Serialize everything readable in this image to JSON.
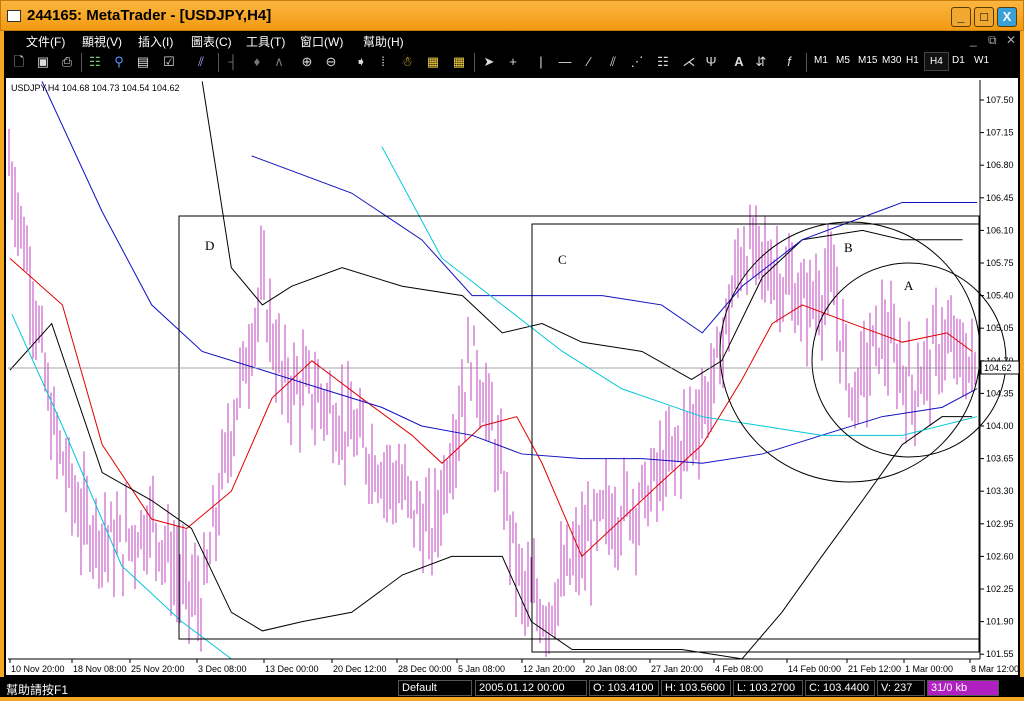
{
  "window": {
    "title": "244165: MetaTrader - [USDJPY,H4]",
    "min": "_",
    "max": "□",
    "close": "X"
  },
  "menu": [
    "文件(F)",
    "顯視(V)",
    "插入(I)",
    "圖表(C)",
    "工具(T)",
    "窗口(W)",
    "幫助(H)"
  ],
  "timeframes": [
    "M1",
    "M5",
    "M15",
    "M30",
    "H1",
    "H4",
    "D1",
    "W1"
  ],
  "active_timeframe": "H4",
  "chart": {
    "header": "USDJPY,H4  104.68 104.73 104.54 104.62",
    "current_price": "104.62",
    "price_ticks": [
      "107.50",
      "107.15",
      "106.80",
      "106.45",
      "106.10",
      "105.75",
      "105.40",
      "105.05",
      "104.70",
      "104.35",
      "104.00",
      "103.65",
      "103.30",
      "102.95",
      "102.60",
      "102.25",
      "101.90",
      "101.55"
    ],
    "date_ticks": [
      "10 Nov 20:00",
      "18 Nov 08:00",
      "25 Nov 20:00",
      "3 Dec 08:00",
      "13 Dec 00:00",
      "20 Dec 12:00",
      "28 Dec 00:00",
      "5 Jan 08:00",
      "12 Jan 20:00",
      "20 Jan 08:00",
      "27 Jan 20:00",
      "4 Feb 08:00",
      "14 Feb 00:00",
      "21 Feb 12:00",
      "1 Mar 00:00",
      "8 Mar 12:00"
    ],
    "labels": {
      "A": "A",
      "B": "B",
      "C": "C",
      "D": "D"
    }
  },
  "chart_data": {
    "type": "line",
    "ylim": [
      101.45,
      107.7
    ],
    "xlim": [
      0,
      100
    ],
    "price": [
      [
        0,
        106.9
      ],
      [
        2.5,
        105.5
      ],
      [
        4.5,
        104.0
      ],
      [
        7.5,
        103.0
      ],
      [
        11.6,
        102.7
      ],
      [
        14.8,
        103.0
      ],
      [
        17.9,
        102.3
      ],
      [
        20,
        102.1
      ],
      [
        23,
        104.0
      ],
      [
        26.2,
        105.5
      ],
      [
        28.2,
        104.5
      ],
      [
        32.3,
        104.3
      ],
      [
        36.4,
        103.8
      ],
      [
        40.6,
        103.3
      ],
      [
        43.7,
        102.8
      ],
      [
        47.8,
        104.8
      ],
      [
        49.8,
        104.0
      ],
      [
        53,
        102.2
      ],
      [
        55.5,
        102.0
      ],
      [
        58.1,
        102.5
      ],
      [
        61.2,
        103.0
      ],
      [
        65.3,
        103.2
      ],
      [
        69.4,
        103.8
      ],
      [
        72.5,
        104.4
      ],
      [
        75.6,
        105.9
      ],
      [
        78.7,
        105.7
      ],
      [
        81.8,
        105.3
      ],
      [
        84.9,
        105.5
      ],
      [
        86.9,
        104.3
      ],
      [
        90,
        105.0
      ],
      [
        93.1,
        104.4
      ],
      [
        96.2,
        104.9
      ],
      [
        99.3,
        104.62
      ]
    ],
    "series": [
      {
        "name": "ma-red",
        "color": "#e00000",
        "points": [
          [
            0.2,
            105.8
          ],
          [
            5.6,
            105.3
          ],
          [
            9.7,
            103.8
          ],
          [
            14.8,
            103.0
          ],
          [
            18.4,
            102.9
          ],
          [
            23,
            103.3
          ],
          [
            27.2,
            104.3
          ],
          [
            31.3,
            104.7
          ],
          [
            36.4,
            104.3
          ],
          [
            41.6,
            103.9
          ],
          [
            44.7,
            103.6
          ],
          [
            48.8,
            104.0
          ],
          [
            52.4,
            104.1
          ],
          [
            55,
            103.6
          ],
          [
            59.1,
            102.6
          ],
          [
            63.2,
            103.0
          ],
          [
            67.3,
            103.4
          ],
          [
            71.5,
            103.8
          ],
          [
            75.6,
            104.5
          ],
          [
            78.7,
            105.1
          ],
          [
            81.8,
            105.3
          ],
          [
            86.9,
            105.1
          ],
          [
            92.1,
            104.9
          ],
          [
            96.7,
            105.0
          ],
          [
            99.3,
            104.8
          ]
        ]
      },
      {
        "name": "band-upper",
        "color": "#000000",
        "points": [
          [
            20,
            107.7
          ],
          [
            23,
            105.7
          ],
          [
            26.2,
            105.3
          ],
          [
            29.2,
            105.5
          ],
          [
            34.4,
            105.7
          ],
          [
            40.6,
            105.5
          ],
          [
            46.8,
            105.4
          ],
          [
            50.9,
            105.0
          ],
          [
            55,
            105.1
          ],
          [
            59.1,
            104.9
          ],
          [
            65.3,
            104.8
          ],
          [
            70.4,
            104.5
          ],
          [
            73.5,
            104.7
          ],
          [
            77.7,
            105.6
          ],
          [
            81.8,
            106.0
          ],
          [
            88,
            106.1
          ],
          [
            92.1,
            106.0
          ],
          [
            98.3,
            106.0
          ]
        ]
      },
      {
        "name": "band-lower",
        "color": "#000000",
        "points": [
          [
            0.2,
            104.6
          ],
          [
            4.5,
            105.1
          ],
          [
            9.7,
            103.5
          ],
          [
            14.8,
            103.2
          ],
          [
            18.9,
            102.9
          ],
          [
            23,
            102.0
          ],
          [
            26.2,
            101.8
          ],
          [
            30.3,
            101.9
          ],
          [
            35.4,
            102.0
          ],
          [
            40.6,
            102.4
          ],
          [
            45.7,
            102.6
          ],
          [
            50.9,
            102.6
          ],
          [
            53.9,
            101.9
          ],
          [
            58.1,
            101.6
          ],
          [
            63.2,
            101.6
          ],
          [
            69.4,
            101.6
          ],
          [
            75.6,
            101.5
          ],
          [
            79.7,
            102.0
          ],
          [
            83.8,
            102.6
          ],
          [
            88,
            103.2
          ],
          [
            92.1,
            103.8
          ],
          [
            96.2,
            104.1
          ],
          [
            99.3,
            104.1
          ]
        ]
      },
      {
        "name": "ma-blue",
        "color": "#1010c0",
        "points": [
          [
            3.5,
            107.7
          ],
          [
            9.7,
            106.3
          ],
          [
            14.8,
            105.3
          ],
          [
            20,
            104.8
          ],
          [
            26.2,
            104.6
          ],
          [
            32.3,
            104.4
          ],
          [
            38.5,
            104.2
          ],
          [
            42.6,
            104.0
          ],
          [
            47.8,
            103.9
          ],
          [
            52.9,
            103.7
          ],
          [
            59.1,
            103.65
          ],
          [
            65.3,
            103.65
          ],
          [
            71.5,
            103.6
          ],
          [
            77.7,
            103.7
          ],
          [
            83.8,
            103.9
          ],
          [
            90,
            104.1
          ],
          [
            96.2,
            104.2
          ],
          [
            99.8,
            104.4
          ]
        ]
      },
      {
        "name": "ma-blue-2",
        "color": "#1010c0",
        "points": [
          [
            25.1,
            106.9
          ],
          [
            35.4,
            106.5
          ],
          [
            42.6,
            106.0
          ],
          [
            47.8,
            105.4
          ],
          [
            52.9,
            105.4
          ],
          [
            61.2,
            105.4
          ],
          [
            67.3,
            105.3
          ],
          [
            71.5,
            105.0
          ],
          [
            75.6,
            105.5
          ],
          [
            81.8,
            106.0
          ],
          [
            92.1,
            106.4
          ],
          [
            99.8,
            106.4
          ]
        ]
      },
      {
        "name": "ma-cyan",
        "color": "#00c8d8",
        "points": [
          [
            0.4,
            105.2
          ],
          [
            5.6,
            104.0
          ],
          [
            11.7,
            102.5
          ],
          [
            17.9,
            101.9
          ],
          [
            23,
            101.5
          ]
        ]
      },
      {
        "name": "ma-cyan-2",
        "color": "#00c8d8",
        "points": [
          [
            38.5,
            107.0
          ],
          [
            44.7,
            105.8
          ],
          [
            50.9,
            105.3
          ],
          [
            57.1,
            104.8
          ],
          [
            63.2,
            104.4
          ],
          [
            71.5,
            104.1
          ],
          [
            77.7,
            104.0
          ],
          [
            83.8,
            103.9
          ],
          [
            92.1,
            103.9
          ],
          [
            99.8,
            104.1
          ]
        ]
      }
    ]
  },
  "status": {
    "help": "幫助請按F1",
    "profile": "Default",
    "time": "2005.01.12 00:00",
    "open": "O: 103.4100",
    "high": "H: 103.5600",
    "low": "L: 103.2700",
    "close": "C: 103.4400",
    "volume": "V: 237",
    "traffic": "31/0 kb"
  }
}
